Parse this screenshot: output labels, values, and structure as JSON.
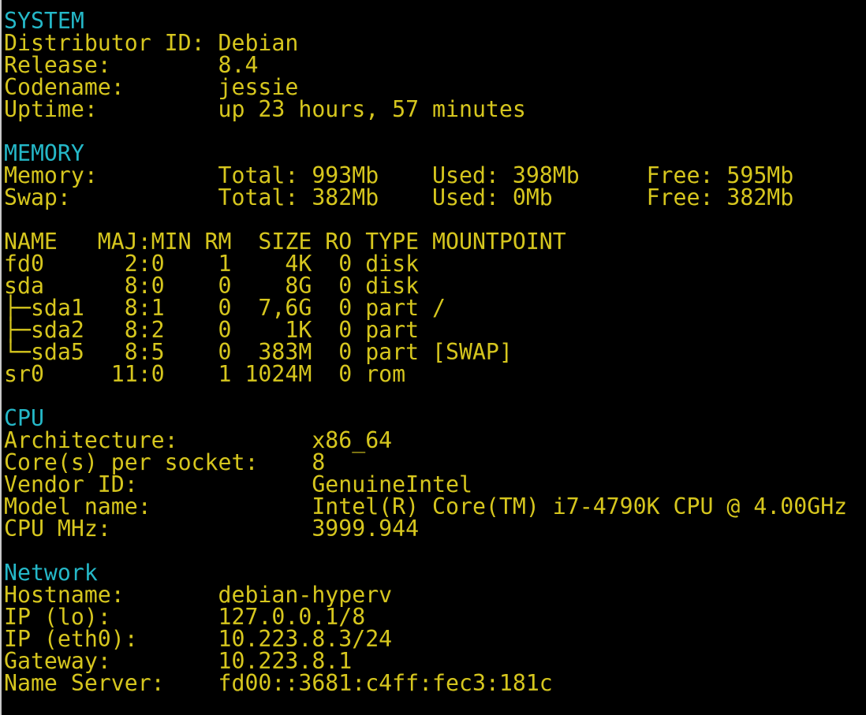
{
  "colors": {
    "background": "#000000",
    "text": "#d6c61e",
    "heading": "#25b8c8"
  },
  "lines": [
    {
      "type": "heading",
      "text": "SYSTEM"
    },
    {
      "type": "text",
      "text": "Distributor ID: Debian"
    },
    {
      "type": "text",
      "text": "Release:        8.4"
    },
    {
      "type": "text",
      "text": "Codename:       jessie"
    },
    {
      "type": "text",
      "text": "Uptime:         up 23 hours, 57 minutes"
    },
    {
      "type": "blank",
      "text": ""
    },
    {
      "type": "heading",
      "text": "MEMORY"
    },
    {
      "type": "text",
      "text": "Memory:         Total: 993Mb    Used: 398Mb     Free: 595Mb"
    },
    {
      "type": "text",
      "text": "Swap:           Total: 382Mb    Used: 0Mb       Free: 382Mb"
    },
    {
      "type": "blank",
      "text": ""
    },
    {
      "type": "text",
      "text": "NAME   MAJ:MIN RM  SIZE RO TYPE MOUNTPOINT"
    },
    {
      "type": "text",
      "text": "fd0      2:0    1    4K  0 disk"
    },
    {
      "type": "text",
      "text": "sda      8:0    0    8G  0 disk"
    },
    {
      "type": "text",
      "text": "├─sda1   8:1    0  7,6G  0 part /"
    },
    {
      "type": "text",
      "text": "├─sda2   8:2    0    1K  0 part"
    },
    {
      "type": "text",
      "text": "└─sda5   8:5    0  383M  0 part [SWAP]"
    },
    {
      "type": "text",
      "text": "sr0     11:0    1 1024M  0 rom"
    },
    {
      "type": "blank",
      "text": ""
    },
    {
      "type": "heading",
      "text": "CPU"
    },
    {
      "type": "text",
      "text": "Architecture:          x86_64"
    },
    {
      "type": "text",
      "text": "Core(s) per socket:    8"
    },
    {
      "type": "text",
      "text": "Vendor ID:             GenuineIntel"
    },
    {
      "type": "text",
      "text": "Model name:            Intel(R) Core(TM) i7-4790K CPU @ 4.00GHz"
    },
    {
      "type": "text",
      "text": "CPU MHz:               3999.944"
    },
    {
      "type": "blank",
      "text": ""
    },
    {
      "type": "heading",
      "text": "Network"
    },
    {
      "type": "text",
      "text": "Hostname:       debian-hyperv"
    },
    {
      "type": "text",
      "text": "IP (lo):        127.0.0.1/8"
    },
    {
      "type": "text",
      "text": "IP (eth0):      10.223.8.3/24"
    },
    {
      "type": "text",
      "text": "Gateway:        10.223.8.1"
    },
    {
      "type": "text",
      "text": "Name Server:    fd00::3681:c4ff:fec3:181c"
    }
  ]
}
